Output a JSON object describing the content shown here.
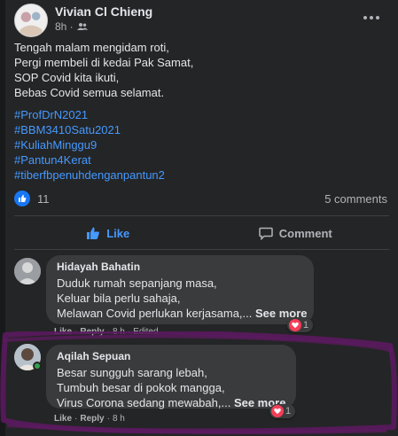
{
  "post": {
    "author": "Vivian Cl Chieng",
    "time": "8h ·",
    "privacy_icon": "friends-icon",
    "lines": [
      "Tengah malam mengidam roti,",
      "Pergi membeli di kedai Pak Samat,",
      "SOP Covid kita ikuti,",
      "Bebas Covid semua selamat."
    ],
    "hashtags": [
      "#ProfDrN2021",
      "#BBM3410Satu2021",
      "#KuliahMinggu9",
      "#Pantun4Kerat",
      "#tiberfbpenuhdenganpantun2"
    ],
    "reaction_count": "11",
    "comments_count": "5 comments"
  },
  "actions": {
    "like_label": "Like",
    "comment_label": "Comment"
  },
  "comments": [
    {
      "author": "Hidayah Bahatin",
      "lines": [
        "Duduk rumah sepanjang masa,",
        "Keluar bila perlu sahaja,",
        "Melawan Covid perlukan kerjasama,... "
      ],
      "see_more": "See more",
      "reactions": "1",
      "like": "Like",
      "reply": "Reply",
      "time": "8 h",
      "edited": "Edited"
    },
    {
      "author": "Aqilah Sepuan",
      "lines": [
        "Besar sungguh sarang lebah,",
        "Tumbuh besar di pokok mangga,",
        "Virus Corona sedang mewabah,... "
      ],
      "see_more": "See more",
      "reactions": "1",
      "like": "Like",
      "reply": "Reply",
      "time": "8 h"
    }
  ],
  "colors": {
    "background": "#242526",
    "link": "#4599ff",
    "like_active": "#4599ff",
    "heart": "#f33e58",
    "annotation": "#5b1a5f"
  }
}
